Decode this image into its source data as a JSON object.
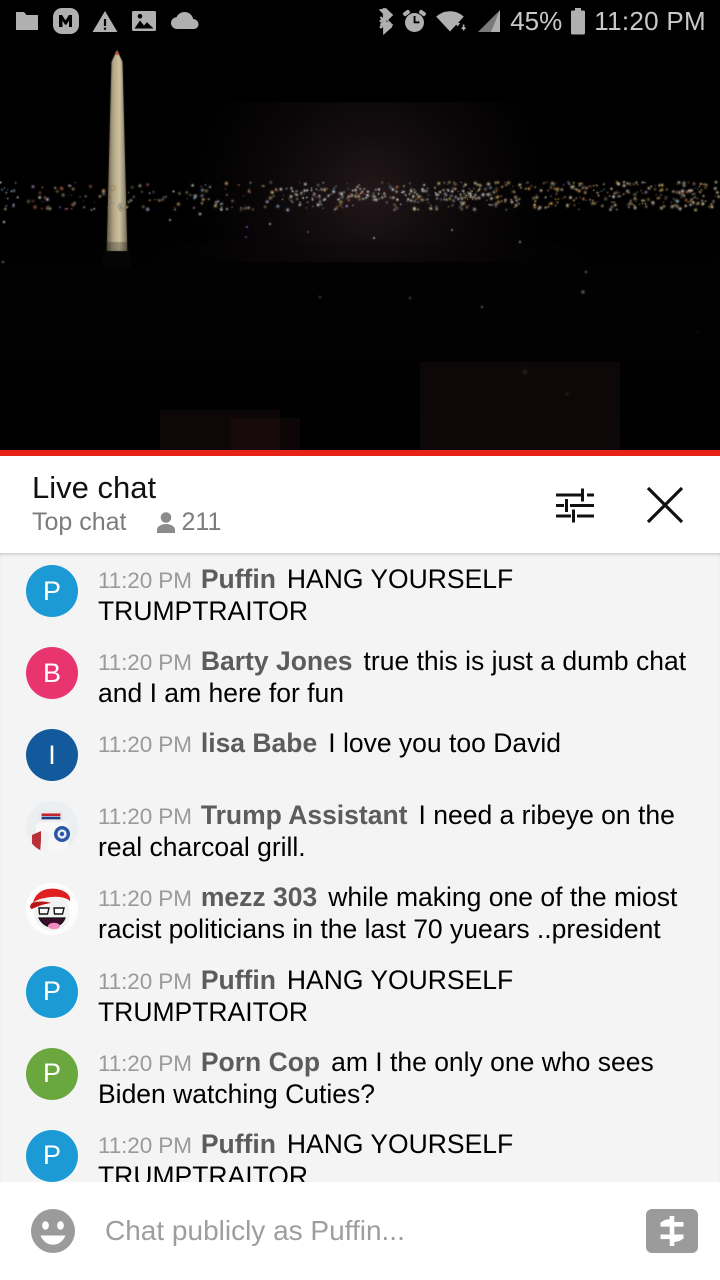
{
  "statusbar": {
    "left_icons": [
      "folder-icon",
      "m-app-icon",
      "warning-icon",
      "image-icon",
      "cloud-icon"
    ],
    "right_icons": [
      "bluetooth-icon",
      "alarm-icon",
      "wifi-icon",
      "signal-icon",
      "battery-icon"
    ],
    "battery_percent": "45%",
    "time": "11:20 PM"
  },
  "video": {
    "name": "washington-monument-night-livestream",
    "progress_color": "#e62117",
    "progress_percent": 100
  },
  "chat_header": {
    "title": "Live chat",
    "mode": "Top chat",
    "viewer_count": "211",
    "viewer_icon": "person-icon",
    "settings_icon": "tune-icon",
    "close_icon": "close-icon"
  },
  "messages": [
    {
      "time": "11:20 PM",
      "author": "Puffin",
      "text": "HANG YOURSELF TRUMPTRAITOR",
      "avatar_type": "letter",
      "avatar_letter": "P",
      "avatar_color": "#1b9ad6"
    },
    {
      "time": "11:20 PM",
      "author": "Barty Jones",
      "text": "true this is just a dumb chat and I am here for fun",
      "avatar_type": "letter",
      "avatar_letter": "B",
      "avatar_color": "#e8346f"
    },
    {
      "time": "11:20 PM",
      "author": "lisa Babe",
      "text": "I love you too David",
      "avatar_type": "letter",
      "avatar_letter": "I",
      "avatar_color": "#125a9c"
    },
    {
      "time": "11:20 PM",
      "author": "Trump Assistant",
      "text": "I need a ribeye on the real charcoal grill.",
      "avatar_type": "photo-maga-shirt",
      "avatar_letter": "",
      "avatar_color": "#f1f1f1"
    },
    {
      "time": "11:20 PM",
      "author": "mezz 303",
      "text": "while making one of the miost racist politicians in the last 70 yuears ..president",
      "avatar_type": "photo-awesome-face-cap",
      "avatar_letter": "",
      "avatar_color": "#ffffff"
    },
    {
      "time": "11:20 PM",
      "author": "Puffin",
      "text": "HANG YOURSELF TRUMPTRAITOR",
      "avatar_type": "letter",
      "avatar_letter": "P",
      "avatar_color": "#1b9ad6"
    },
    {
      "time": "11:20 PM",
      "author": "Porn Cop",
      "text": "am I the only one who sees Biden watching Cuties?",
      "avatar_type": "letter",
      "avatar_letter": "P",
      "avatar_color": "#6aa83f"
    },
    {
      "time": "11:20 PM",
      "author": "Puffin",
      "text": "HANG YOURSELF TRUMPTRAITOR",
      "avatar_type": "letter",
      "avatar_letter": "P",
      "avatar_color": "#1b9ad6"
    }
  ],
  "input_bar": {
    "emoji_icon": "emoji-smiley-icon",
    "placeholder": "Chat publicly as Puffin...",
    "value": "",
    "superchat_icon": "dollar-icon"
  }
}
